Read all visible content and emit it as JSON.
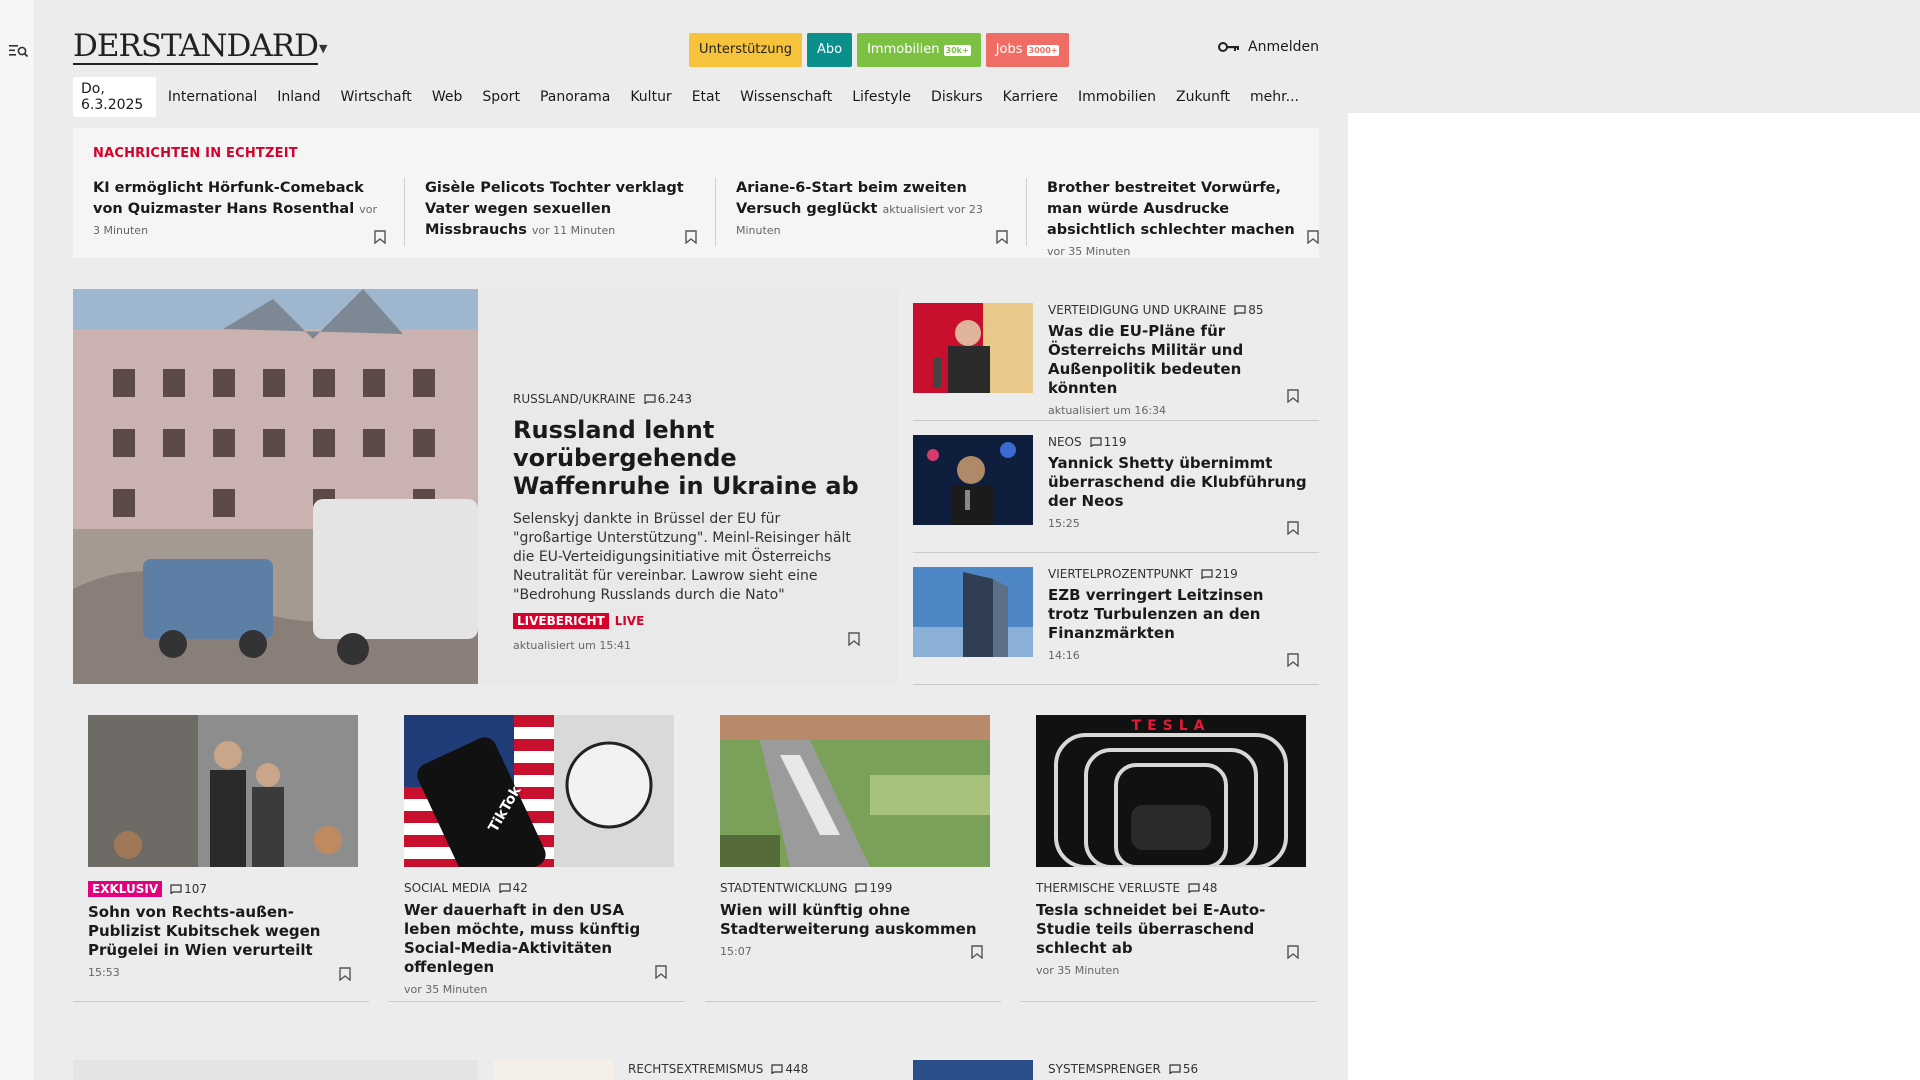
{
  "site": {
    "logo": "DERSTANDARD",
    "search_icon": "search-menu-icon"
  },
  "header": {
    "pills": [
      {
        "label": "Unterstützung",
        "tag": ""
      },
      {
        "label": "Abo",
        "tag": ""
      },
      {
        "label": "Immobilien",
        "tag": "30k+"
      },
      {
        "label": "Jobs",
        "tag": "3000+"
      }
    ],
    "login_label": "Anmelden"
  },
  "nav": {
    "date": "Do, 6.3.2025",
    "items": [
      "International",
      "Inland",
      "Wirtschaft",
      "Web",
      "Sport",
      "Panorama",
      "Kultur",
      "Etat",
      "Wissenschaft",
      "Lifestyle",
      "Diskurs",
      "Karriere",
      "Immobilien",
      "Zukunft",
      "mehr..."
    ]
  },
  "realtime": {
    "heading": "NACHRICHTEN IN ECHTZEIT",
    "items": [
      {
        "title": "KI ermöglicht Hörfunk-Comeback von Quizmaster Hans Rosenthal",
        "meta": "vor 3 Minuten"
      },
      {
        "title": "Gisèle Pelicots Tochter verklagt Vater wegen sexuellen Missbrauchs",
        "meta": "vor 11 Minuten"
      },
      {
        "title": "Ariane-6-Start beim zweiten Versuch geglückt",
        "meta": "aktualisiert vor 23 Minuten"
      },
      {
        "title": "Brother bestreitet Vorwürfe, man würde Ausdrucke absichtlich schlechter machen",
        "meta": "vor 35 Minuten"
      }
    ]
  },
  "hero": {
    "kicker": "RUSSLAND/UKRAINE",
    "comments": "6.243",
    "title": "Russland lehnt vorübergehende Waffenruhe in Ukraine ab",
    "teaser": "Selenskyj dankte in Brüssel der EU für \"großartige Unterstützung\". Meinl-Reisinger hält die EU-Verteidigungsinitiative mit Österreichs Neutralität für vereinbar. Lawrow sieht eine \"Bedrohung Russlands durch die Nato\"",
    "live_badge": "LIVEBERICHT",
    "live_word": "LIVE",
    "meta": "aktualisiert um 15:41"
  },
  "side": [
    {
      "kicker": "VERTEIDIGUNG UND UKRAINE",
      "comments": "85",
      "title": "Was die EU-Pläne für Österreichs Militär und Außenpolitik bedeuten könnten",
      "meta": "aktualisiert um 16:34"
    },
    {
      "kicker": "NEOS",
      "comments": "119",
      "title": "Yannick Shetty übernimmt überraschend die Klubführung der Neos",
      "meta": "15:25"
    },
    {
      "kicker": "VIERTELPROZENTPUNKT",
      "comments": "219",
      "title": "EZB verringert Leitzinsen trotz Turbulenzen an den Finanzmärkten",
      "meta": "14:16"
    }
  ],
  "cards": [
    {
      "badge": "EXKLUSIV",
      "kicker": "",
      "comments": "107",
      "title": "Sohn von Rechts-außen-Publizist Kubitschek wegen Prügelei in Wien verurteilt",
      "meta": "15:53"
    },
    {
      "badge": "",
      "kicker": "SOCIAL MEDIA",
      "comments": "42",
      "title": "Wer dauerhaft in den USA leben möchte, muss künftig Social-Media-Aktivitäten offenlegen",
      "meta": "vor 35 Minuten"
    },
    {
      "badge": "",
      "kicker": "STADTENTWICKLUNG",
      "comments": "199",
      "title": "Wien will künftig ohne Stadterweiterung auskommen",
      "meta": "15:07"
    },
    {
      "badge": "",
      "kicker": "THERMISCHE VERLUSTE",
      "comments": "48",
      "title": "Tesla schneidet bei E-Auto-Studie teils überraschend schlecht ab",
      "meta": "vor 35 Minuten"
    }
  ],
  "bottom": [
    {
      "kicker": "RECHTSEXTREMISMUS",
      "comments": "448"
    },
    {
      "kicker": "SYSTEMSPRENGER",
      "comments": "56"
    }
  ],
  "image_texts": {
    "tiktok": "TikTok",
    "tesla": "TESLA"
  }
}
